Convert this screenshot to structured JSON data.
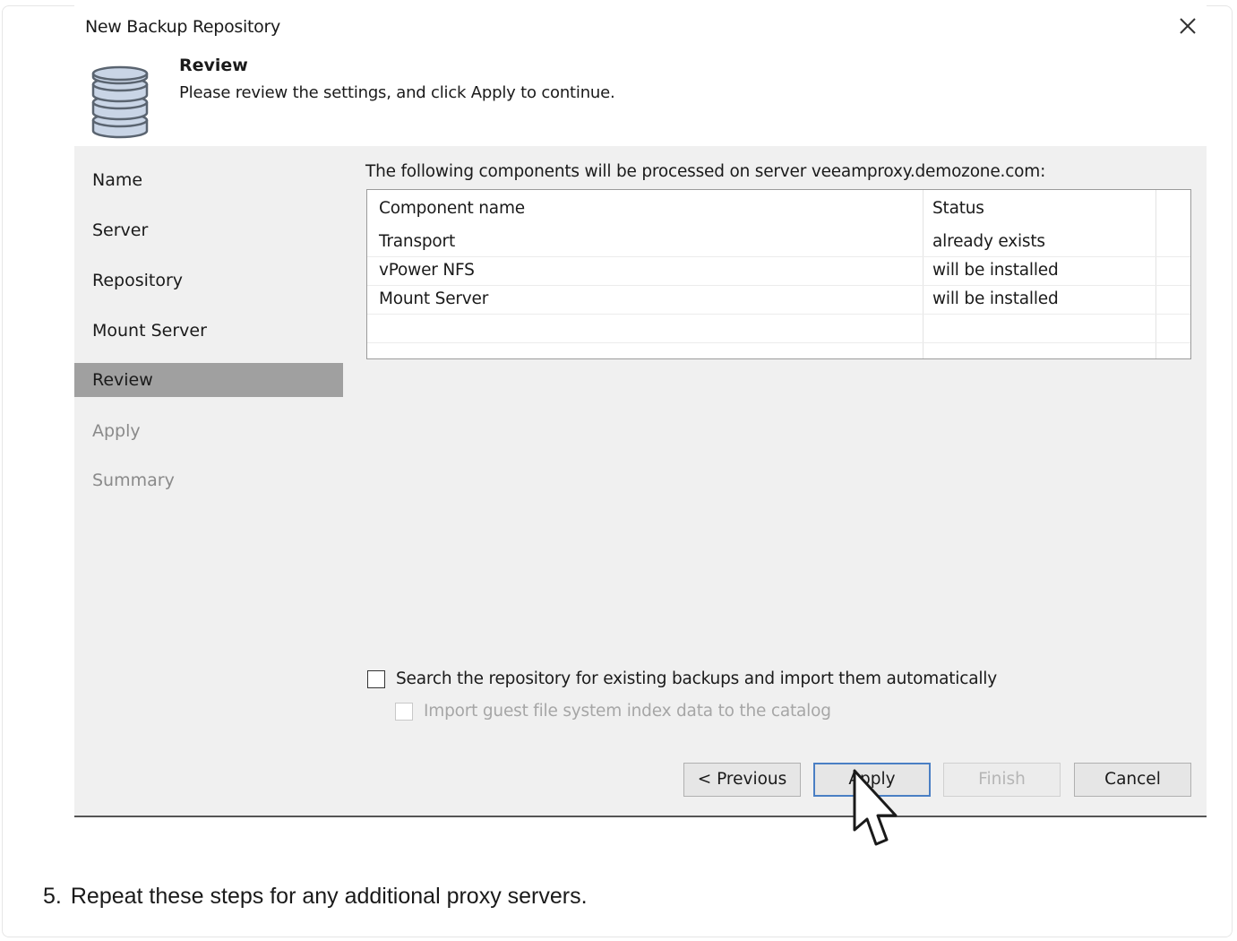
{
  "dialog": {
    "title": "New Backup Repository",
    "close_glyph": "✕"
  },
  "header": {
    "icon": "database-icon",
    "title": "Review",
    "subtitle": "Please review the settings, and click Apply to continue."
  },
  "sidebar": {
    "items": [
      {
        "label": "Name",
        "state": "normal"
      },
      {
        "label": "Server",
        "state": "normal"
      },
      {
        "label": "Repository",
        "state": "normal"
      },
      {
        "label": "Mount Server",
        "state": "normal"
      },
      {
        "label": "Review",
        "state": "active"
      },
      {
        "label": "Apply",
        "state": "disabled"
      },
      {
        "label": "Summary",
        "state": "disabled"
      }
    ]
  },
  "main": {
    "intro": "The following components will be processed on server veeamproxy.demozone.com:",
    "table": {
      "columns": [
        "Component name",
        "Status"
      ],
      "rows": [
        [
          "Transport",
          "already exists"
        ],
        [
          "vPower NFS",
          "will be installed"
        ],
        [
          "Mount Server",
          "will be installed"
        ]
      ]
    },
    "options": {
      "search_backups": {
        "label": "Search the repository for existing backups and import them automatically",
        "checked": false,
        "enabled": true
      },
      "import_index": {
        "label": "Import guest file system index data to the catalog",
        "checked": false,
        "enabled": false
      }
    }
  },
  "footer": {
    "previous_label": "< Previous",
    "apply_label": "Apply",
    "finish_label": "Finish",
    "cancel_label": "Cancel"
  },
  "doc": {
    "step_number": "5.",
    "step_text": "Repeat these steps for any additional proxy servers."
  },
  "colors": {
    "active_sidebar": "#a0a0a0",
    "panel_bg": "#f0f0f0",
    "primary_button_border": "#4a7fc4",
    "db_icon_fill": "#c9d5e6",
    "db_icon_stroke": "#5a6470"
  }
}
